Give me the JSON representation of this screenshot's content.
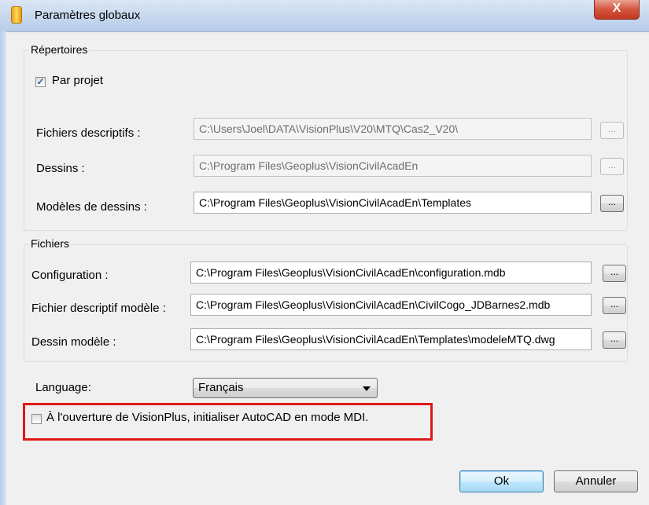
{
  "window": {
    "title": "Paramètres globaux",
    "close_label": "X"
  },
  "repertoires": {
    "legend": "Répertoires",
    "par_projet": {
      "label": "Par projet",
      "checked": true
    },
    "rows": [
      {
        "label": "Fichiers descriptifs :",
        "value": "C:\\Users\\Joel\\DATA\\VisionPlus\\V20\\MTQ\\Cas2_V20\\",
        "browse": "...",
        "enabled": false
      },
      {
        "label": "Dessins :",
        "value": "C:\\Program Files\\Geoplus\\VisionCivilAcadEn",
        "browse": "...",
        "enabled": false
      },
      {
        "label": "Modèles de dessins :",
        "value": "C:\\Program Files\\Geoplus\\VisionCivilAcadEn\\Templates",
        "browse": "...",
        "enabled": true
      }
    ]
  },
  "fichiers": {
    "legend": "Fichiers",
    "rows": [
      {
        "label": "Configuration :",
        "value": "C:\\Program Files\\Geoplus\\VisionCivilAcadEn\\configuration.mdb",
        "browse": "..."
      },
      {
        "label": "Fichier descriptif modèle :",
        "value": "C:\\Program Files\\Geoplus\\VisionCivilAcadEn\\CivilCogo_JDBarnes2.mdb",
        "browse": "..."
      },
      {
        "label": "Dessin modèle :",
        "value": "C:\\Program Files\\Geoplus\\VisionCivilAcadEn\\Templates\\modeleMTQ.dwg",
        "browse": "..."
      }
    ]
  },
  "language": {
    "label": "Language:",
    "selected": "Français"
  },
  "mdi_option": {
    "label": "À l'ouverture de VisionPlus, initialiser AutoCAD en mode MDI.",
    "checked": false
  },
  "buttons": {
    "ok": "Ok",
    "cancel": "Annuler"
  },
  "colors": {
    "highlight": "#e01818",
    "titlebar": "#c6d7ee"
  }
}
